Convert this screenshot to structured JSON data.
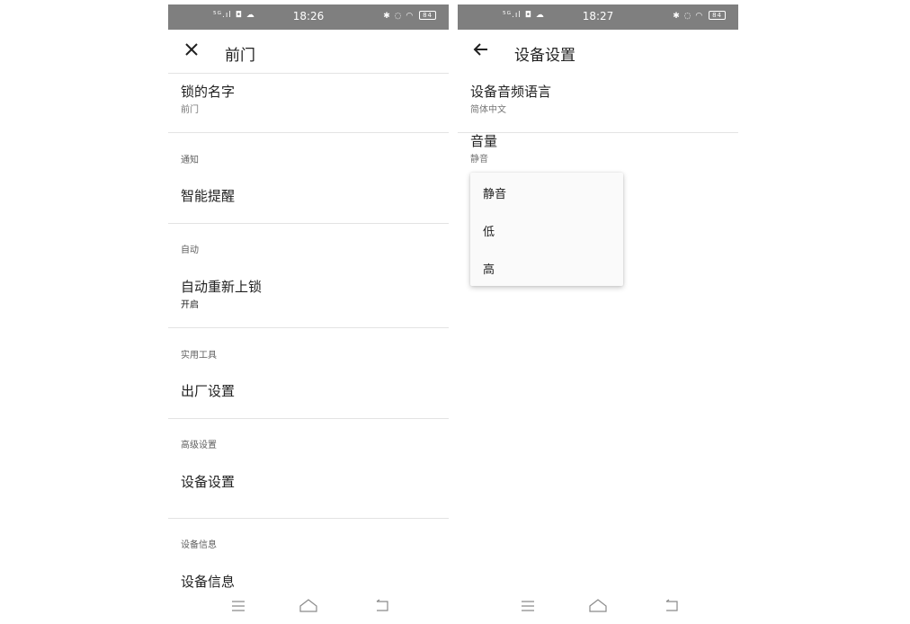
{
  "status_left": {
    "signal": "⁵ᴳ.ıl ◘ ☁",
    "time": "18:26",
    "battery": "84"
  },
  "status_right": {
    "signal": "⁵ᴳ.ıl ◘ ☁",
    "time": "18:27",
    "battery": "84"
  },
  "left_screen": {
    "title": "前门",
    "lock_name": {
      "label": "锁的名字",
      "value": "前门"
    },
    "notification": {
      "section": "通知",
      "smart_alerts": "智能提醒"
    },
    "auto": {
      "section": "自动",
      "auto_relock": "自动重新上锁",
      "auto_relock_value": "开启"
    },
    "tools": {
      "section": "实用工具",
      "factory_reset": "出厂设置"
    },
    "advanced": {
      "section": "高级设置",
      "device_settings": "设备设置"
    },
    "info": {
      "section": "设备信息",
      "device_info": "设备信息"
    }
  },
  "right_screen": {
    "title": "设备设置",
    "audio_language": {
      "label": "设备音频语言",
      "value": "简体中文"
    },
    "volume": {
      "label": "音量",
      "value": "静音"
    },
    "volume_options": [
      "静音",
      "低",
      "高"
    ]
  },
  "icons": {
    "close": "close-icon",
    "back": "arrow-left-icon",
    "nav_menu": "menu-icon",
    "nav_home": "home-icon",
    "nav_back": "back-icon"
  },
  "colors": {
    "status_bar": "#7f7f7f",
    "divider": "#e3e3e3",
    "text": "#212121",
    "secondary": "#757575"
  }
}
